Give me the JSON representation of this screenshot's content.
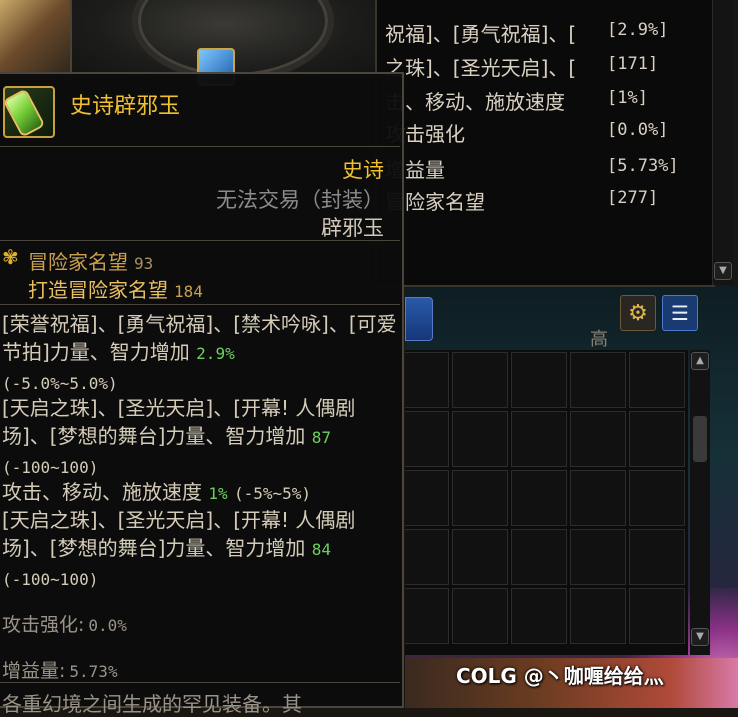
{
  "stats_panel": {
    "rows": [
      {
        "label": "祝福]、[勇气祝福]、[",
        "value": "[2.9%]"
      },
      {
        "label": "之珠]、[圣光天启]、[",
        "value": "[171]"
      },
      {
        "label": "击、移动、施放速度",
        "value": "[1%]"
      },
      {
        "label": "攻击强化",
        "value": "[0.0%]"
      },
      {
        "label": "增益量",
        "value": "[5.73%]"
      },
      {
        "label": "冒险家名望",
        "value": "[277]"
      }
    ],
    "scroll_icon": "chevron-down-icon"
  },
  "inventory": {
    "hint_text": "高",
    "gear_icon": "gear-icon",
    "list_icon": "list-icon",
    "columns": 5,
    "rows": 5
  },
  "tooltip": {
    "item_icon": "jade-talisman-icon",
    "name": "史诗辟邪玉",
    "rarity": "史诗",
    "trade": "无法交易（封装）",
    "type": "辟邪玉",
    "fame_label": "冒险家名望",
    "fame_value": "93",
    "forge_fame_label": "打造冒险家名望",
    "forge_fame_value": "184",
    "options": [
      {
        "text": "[荣誉祝福]、[勇气祝福]、[禁术吟咏]、[可爱节拍]力量、智力增加",
        "value": "2.9%",
        "range": "(-5.0%~5.0%)"
      },
      {
        "text": "[天启之珠]、[圣光天启]、[开幕! 人偶剧场]、[梦想的舞台]力量、智力增加",
        "value": "87",
        "range": "(-100~100)"
      },
      {
        "text": "攻击、移动、施放速度",
        "value": "1%",
        "range": "(-5%~5%)"
      },
      {
        "text": "[天启之珠]、[圣光天启]、[开幕! 人偶剧场]、[梦想的舞台]力量、智力增加",
        "value": "84",
        "range": "(-100~100)"
      }
    ],
    "attack_boost_label": "攻击强化:",
    "attack_boost_value": "0.0%",
    "buff_label": "增益量:",
    "buff_value": "5.73%",
    "flavor_text": "各重幻境之间生成的罕见装备。其"
  },
  "watermark": "COLG @丶咖喱给给灬",
  "colors": {
    "epic_gold": "#f0c030",
    "green_value": "#6cd060",
    "panel_bg": "#0c0c0c"
  }
}
